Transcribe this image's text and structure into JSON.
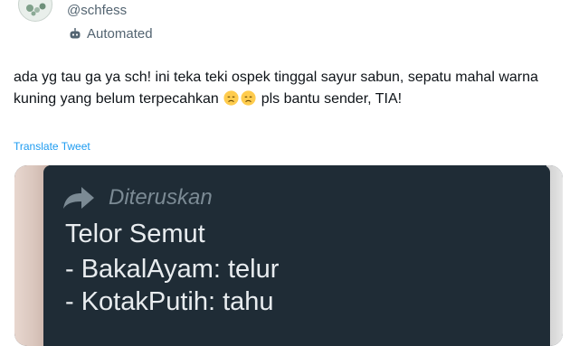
{
  "tweet": {
    "handle": "@schfess",
    "automated_label": "Automated",
    "text_part1": "ada yg tau ga ya sch! ini teka teki ospek tinggal sayur sabun, sepatu mahal warna kuning yang belum terpecahkan ",
    "text_part2": " pls bantu sender, TIA!",
    "translate_label": "Translate Tweet",
    "colors": {
      "link": "#1d9bf0",
      "muted": "#536471",
      "text": "#0f1419"
    }
  },
  "media": {
    "forwarded_label": "Diteruskan",
    "lines": [
      "Telor Semut",
      "- BakalAyam: telur",
      "- KotakPutih: tahu"
    ],
    "colors": {
      "bubble": "#1f2c36",
      "text": "#e8ecef",
      "muted": "#7b8a94"
    }
  },
  "icons": [
    "avatar",
    "bot-icon",
    "disappointed-face-emoji",
    "forward-arrow-icon"
  ]
}
